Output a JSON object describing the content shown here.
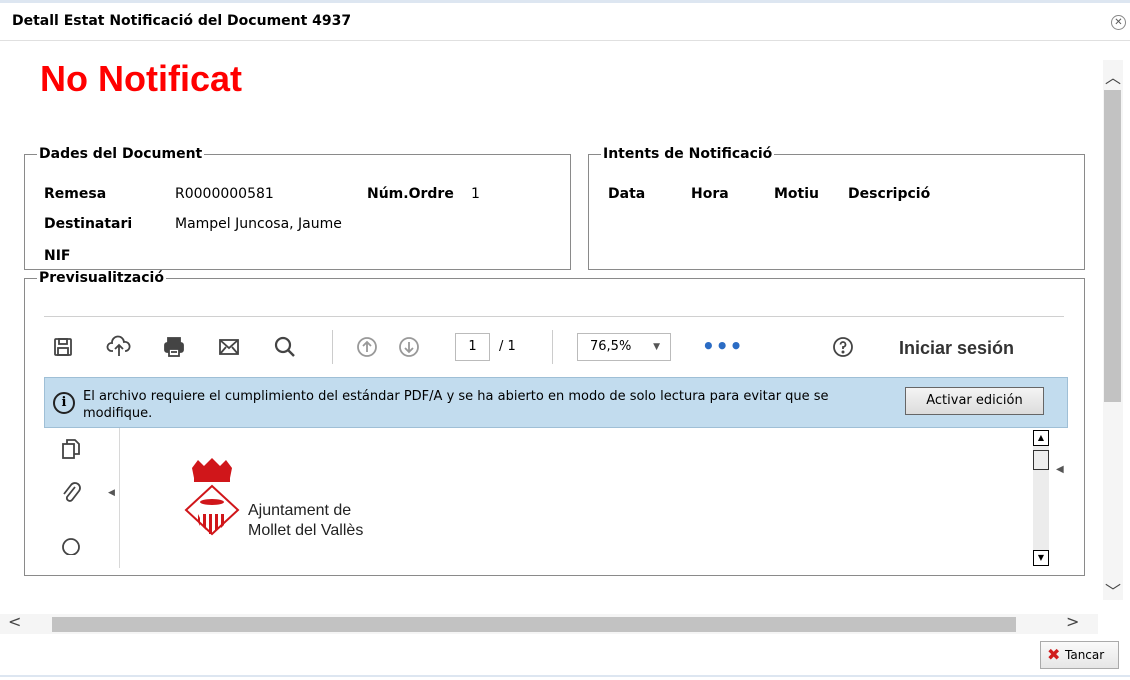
{
  "dialog": {
    "title": "Detall Estat Notificació del Document 4937",
    "close_icon": "close-circle-icon"
  },
  "status": {
    "text": "No Notificat",
    "color": "#ff0000"
  },
  "document": {
    "legend": "Dades del Document",
    "remesa_label": "Remesa",
    "remesa_value": "R0000000581",
    "ordre_label": "Núm.Ordre",
    "ordre_value": "1",
    "destinatari_label": "Destinatari",
    "destinatari_value": "Mampel Juncosa, Jaume",
    "nif_label": "NIF",
    "nif_value": ""
  },
  "intents": {
    "legend": "Intents de Notificació",
    "columns": [
      "Data",
      "Hora",
      "Motiu",
      "Descripció"
    ]
  },
  "preview": {
    "legend": "Previsualització",
    "toolbar": {
      "icons": [
        "save-icon",
        "upload-icon",
        "print-icon",
        "mail-icon",
        "search-icon",
        "arrow-up-icon",
        "arrow-down-icon"
      ],
      "page_current": "1",
      "page_total": "/ 1",
      "zoom": "76,5%",
      "more": "•••",
      "help_icon": "help-icon",
      "signin": "Iniciar sesión"
    },
    "infobar": {
      "icon": "info-icon",
      "message": "El archivo requiere el cumplimiento del estándar PDF/A y se ha abierto en modo de solo lectura para evitar que se modifique.",
      "button": "Activar edición",
      "background": "#c2dcee"
    },
    "sidebar_icons": [
      "pages-icon",
      "attachment-icon",
      "comment-icon"
    ],
    "document": {
      "logo_line1": "Ajuntament de",
      "logo_line2": "Mollet del Vallès"
    }
  },
  "footer": {
    "cancel": "Tancar",
    "cancel_icon": "red-x-icon"
  }
}
